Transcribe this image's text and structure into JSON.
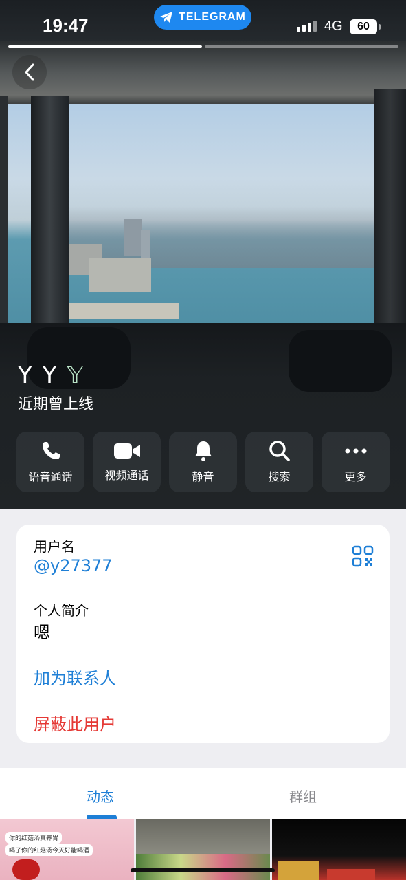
{
  "status_bar": {
    "time": "19:47",
    "app_pill": "TELEGRAM",
    "network": "4G",
    "battery": "60"
  },
  "profile": {
    "name_prefix": "Y Y ",
    "name_fancy": "𝕐",
    "last_seen": "近期曾上线"
  },
  "actions": [
    {
      "label": "语音通话",
      "icon": "phone-icon"
    },
    {
      "label": "视频通话",
      "icon": "video-icon"
    },
    {
      "label": "静音",
      "icon": "bell-icon"
    },
    {
      "label": "搜索",
      "icon": "search-icon"
    },
    {
      "label": "更多",
      "icon": "more-icon"
    }
  ],
  "info": {
    "username_title": "用户名",
    "username_value": "@y27377",
    "bio_title": "个人简介",
    "bio_value": "嗯",
    "add_contact": "加为联系人",
    "block_user": "屏蔽此用户"
  },
  "tabs": {
    "active": "动态",
    "inactive": "群组"
  },
  "grid": {
    "cell1_bubble1": "你的红菇汤真养胃",
    "cell1_bubble2": "喝了你的红菇汤今天好能喝酒"
  },
  "colors": {
    "accent": "#1e7fd6",
    "danger": "#e53935",
    "telegram_pill": "#1e88f0"
  }
}
